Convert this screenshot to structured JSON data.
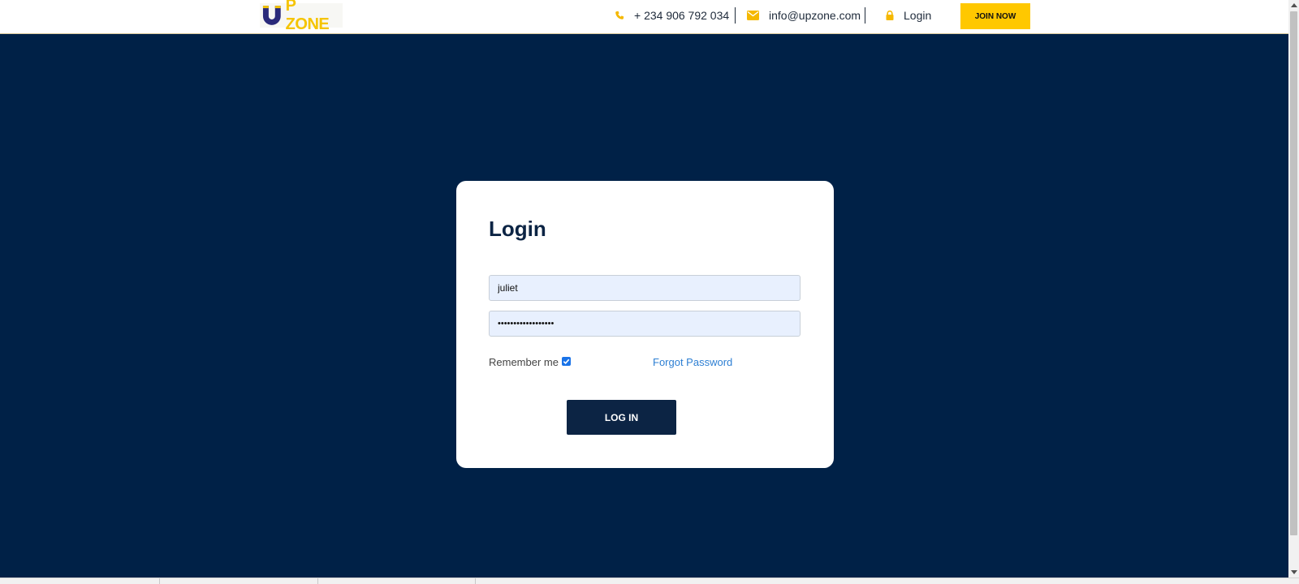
{
  "header": {
    "logo_text": "P ZONE",
    "phone": "+ 234 906 792 034",
    "email": "info@upzone.com",
    "login_label": "Login",
    "join_label": "JOIN NOW"
  },
  "login_card": {
    "title": "Login",
    "username_value": "juliet",
    "password_value": "••••••••••••••••••",
    "remember_label": "Remember me",
    "remember_checked": true,
    "forgot_label": "Forgot Password",
    "submit_label": "LOG IN"
  },
  "colors": {
    "navy": "#002147",
    "accent_yellow": "#ffc800",
    "card_title": "#0c2444",
    "link_blue": "#2d7fd3",
    "input_fill": "#e8f0fe"
  },
  "icons": {
    "logo": "magnet-u-logo",
    "phone": "phone-icon",
    "email": "envelope-icon",
    "login": "lock-icon",
    "checkbox": "checkmark-icon"
  }
}
